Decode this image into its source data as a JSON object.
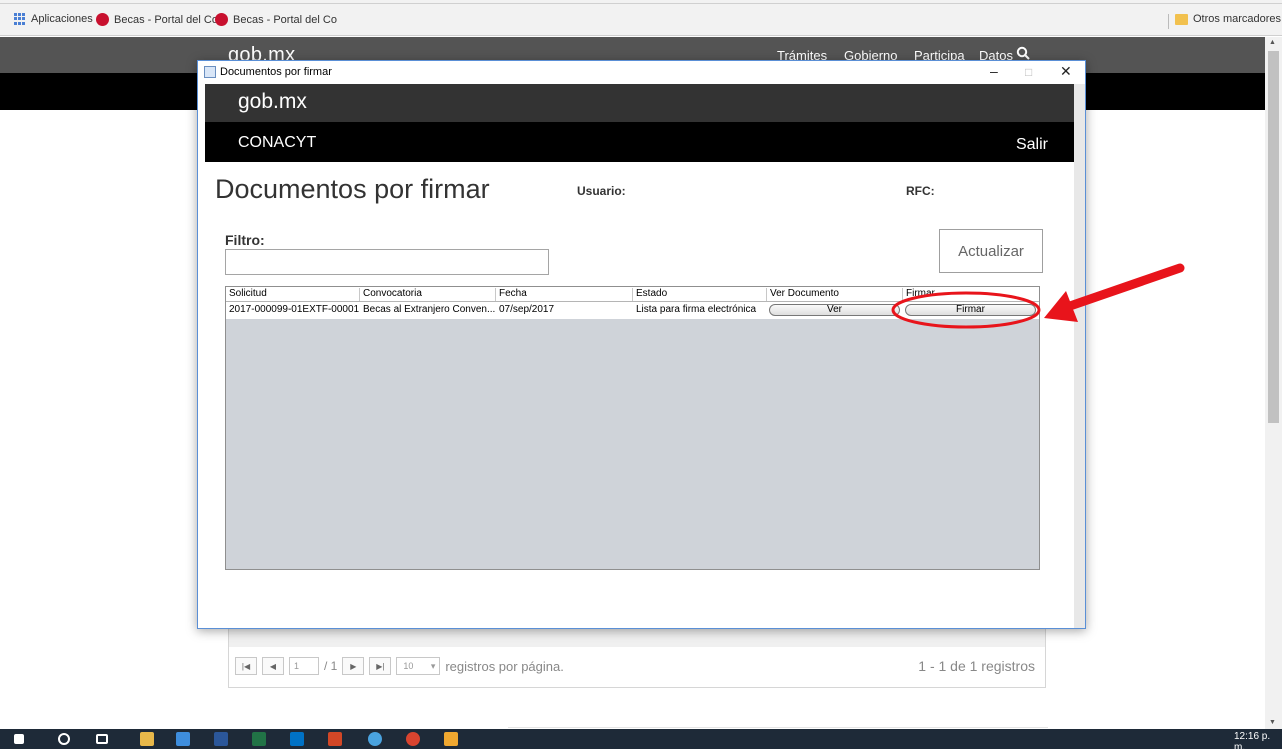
{
  "browser": {
    "bookmarks": [
      {
        "label": "Aplicaciones",
        "icon": "apps-grid-icon"
      },
      {
        "label": "Becas - Portal del Co",
        "icon": "red-circle-icon"
      },
      {
        "label": "Becas - Portal del Co",
        "icon": "red-circle-icon"
      }
    ],
    "other_bookmarks": "Otros marcadores"
  },
  "page": {
    "logo": "gob.mx",
    "nav": [
      "Trámites",
      "Gobierno",
      "Participa",
      "Datos"
    ],
    "pager": {
      "page_value": "1",
      "page_total": "/ 1",
      "per_page": "10",
      "per_page_label": "registros por página.",
      "count": "1 - 1 de 1 registros"
    }
  },
  "dialog": {
    "title": "Documentos por firmar",
    "logo": "gob.mx",
    "org": "CONACYT",
    "exit": "Salir",
    "heading": "Documentos por firmar",
    "user_label": "Usuario:",
    "rfc_label": "RFC:",
    "filter_label": "Filtro:",
    "filter_value": "",
    "refresh_button": "Actualizar",
    "table": {
      "columns": [
        "Solicitud",
        "Convocatoria",
        "Fecha",
        "Estado",
        "Ver Documento",
        "Firmar"
      ],
      "rows": [
        {
          "solicitud": "2017-000099-01EXTF-00001",
          "convocatoria": "Becas al Extranjero Conven...",
          "fecha": "07/sep/2017",
          "estado": "Lista para firma electrónica",
          "ver": "Ver",
          "firmar": "Firmar"
        }
      ]
    }
  },
  "taskbar": {
    "clock": "12:16 p. m."
  },
  "colors": {
    "annotation": "#e8141b",
    "header_dark": "#333333",
    "table_bg": "#cfd3d9"
  }
}
